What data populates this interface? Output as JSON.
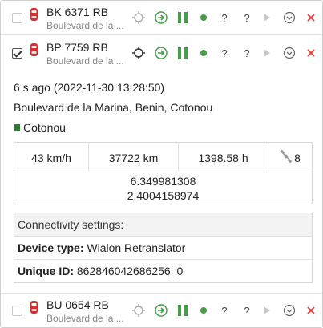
{
  "units": [
    {
      "name": "BK 6371 RB",
      "address": "Boulevard de la ...",
      "checked": false
    },
    {
      "name": "BP 7759 RB",
      "address": "Boulevard de la ...",
      "checked": true
    },
    {
      "name": "BU 0654 RB",
      "address": "Boulevard de la ...",
      "checked": false
    }
  ],
  "actions": {
    "q1": "?",
    "q2": "?"
  },
  "colors": {
    "accent_green": "#43a047",
    "close_red": "#e53935",
    "car_red": "#d32f2f",
    "geofence": "#2e7d32"
  },
  "details": {
    "time": "6 s ago (2022-11-30 13:28:50)",
    "address": "Boulevard de la Marina, Benin, Cotonou",
    "geofence": "Cotonou",
    "speed": "43 km/h",
    "mileage": "37722 km",
    "engine_hours": "1398.58 h",
    "satellites": "8",
    "coord_1": "6.349981308",
    "coord_2": "2.4004158974",
    "connectivity": {
      "header": "Connectivity settings:",
      "device_type_label": "Device type:",
      "device_type_value": "Wialon Retranslator",
      "unique_id_label": "Unique ID:",
      "unique_id_value": "862846042686256_0"
    }
  }
}
